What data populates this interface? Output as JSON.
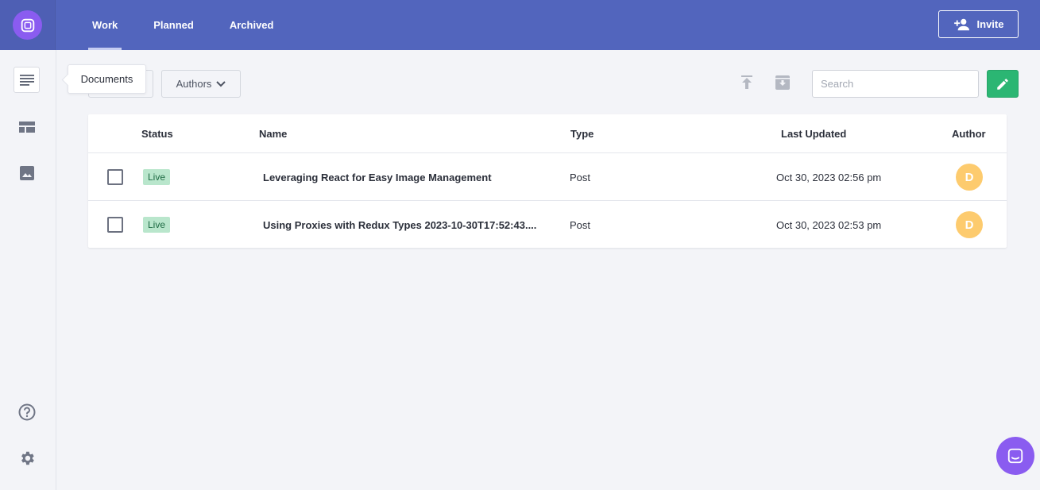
{
  "topbar": {
    "tabs": [
      {
        "label": "Work",
        "active": true
      },
      {
        "label": "Planned",
        "active": false
      },
      {
        "label": "Archived",
        "active": false
      }
    ],
    "invite_label": "Invite"
  },
  "sidebar": {
    "items": [
      {
        "icon": "documents-icon",
        "tooltip": "Documents",
        "active": true
      },
      {
        "icon": "layout-icon",
        "active": false
      },
      {
        "icon": "image-icon",
        "active": false
      }
    ],
    "bottom_items": [
      {
        "icon": "help-icon"
      },
      {
        "icon": "settings-icon"
      }
    ]
  },
  "toolbar": {
    "authors_label": "Authors",
    "search_placeholder": "Search"
  },
  "table": {
    "headers": {
      "status": "Status",
      "name": "Name",
      "type": "Type",
      "last_updated": "Last Updated",
      "author": "Author"
    },
    "rows": [
      {
        "status": "Live",
        "name": "Leveraging React for Easy Image Management",
        "type": "Post",
        "last_updated": "Oct 30, 2023 02:56 pm",
        "author_initial": "D"
      },
      {
        "status": "Live",
        "name": "Using Proxies with Redux Types 2023-10-30T17:52:43....",
        "type": "Post",
        "last_updated": "Oct 30, 2023 02:53 pm",
        "author_initial": "D"
      }
    ]
  },
  "colors": {
    "topbar": "#5265bd",
    "accent_purple": "#8a5cf0",
    "new_button_green": "#2bb673",
    "live_badge": "#b9e6cc",
    "avatar": "#fdcb6e"
  }
}
